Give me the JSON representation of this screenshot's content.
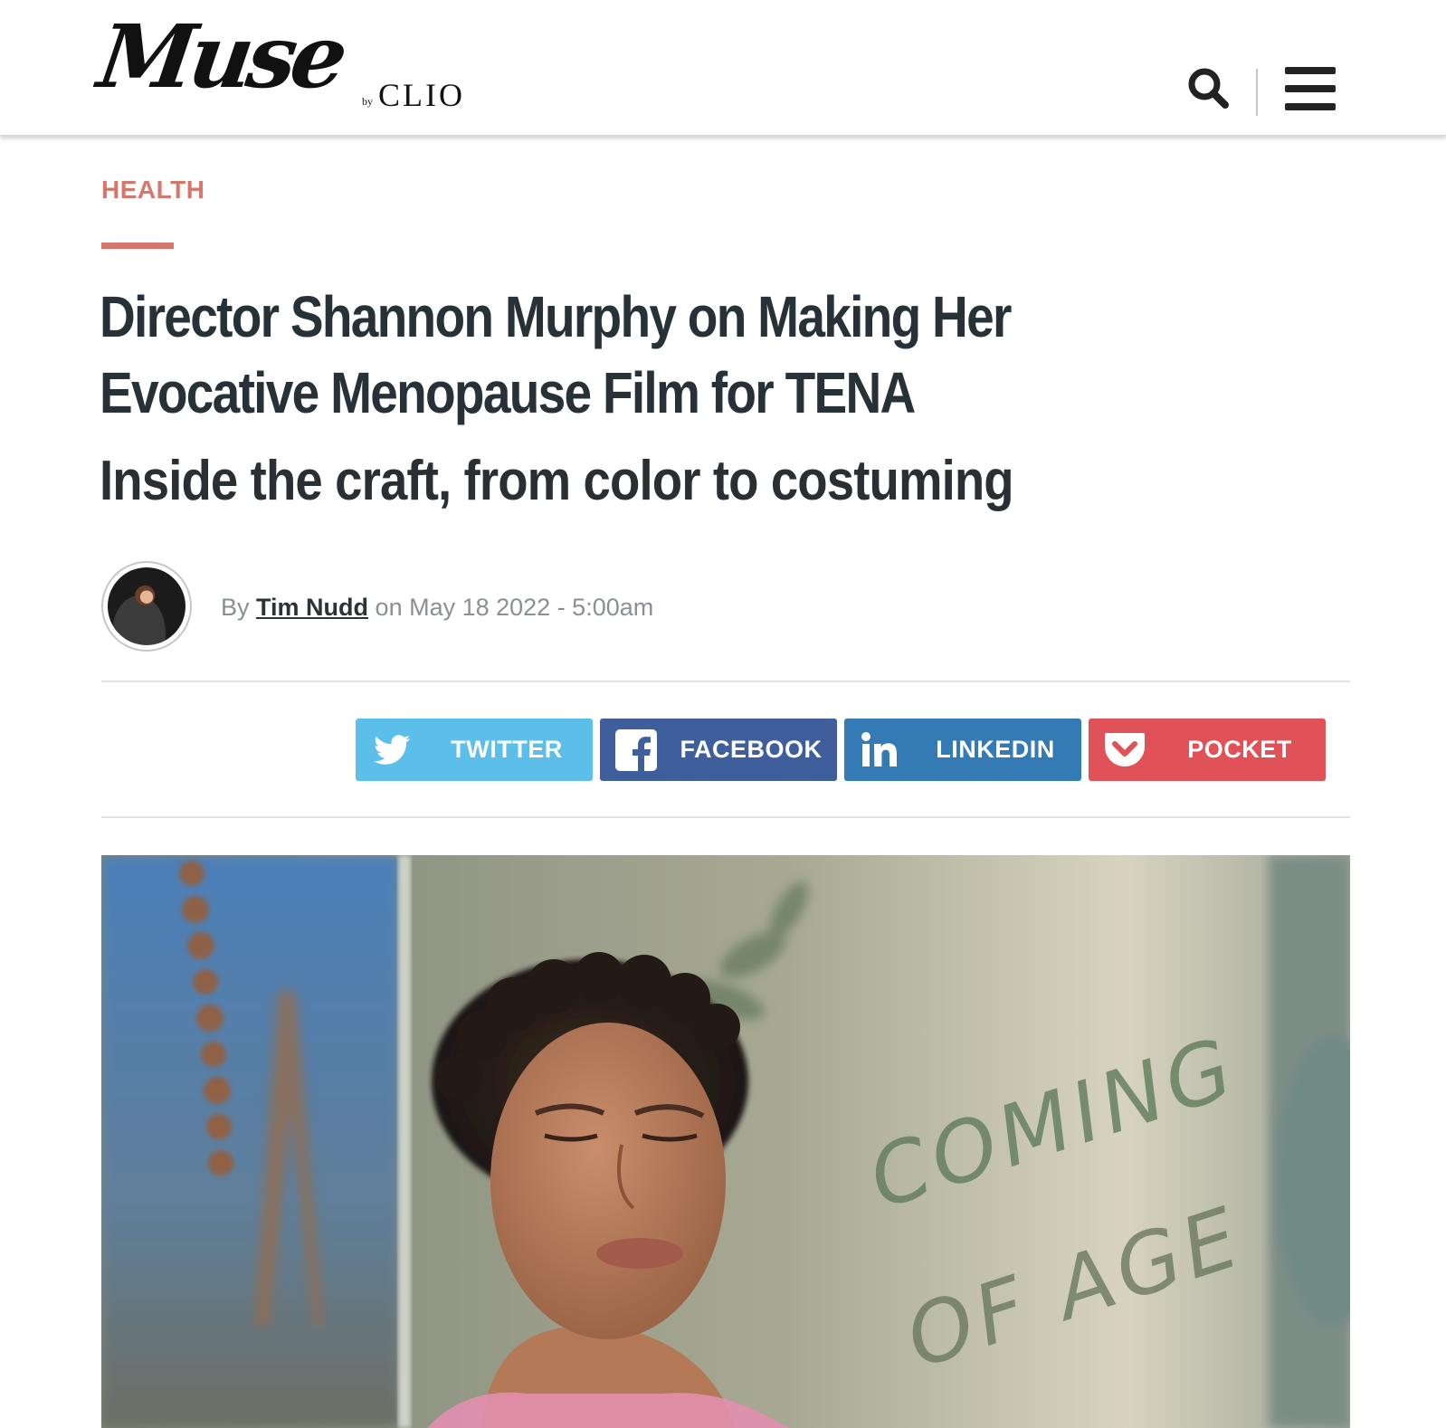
{
  "header": {
    "logo_primary": "Muse",
    "logo_by": "by",
    "logo_secondary": "CLIO",
    "search_icon": "search-icon",
    "menu_icon": "hamburger-menu-icon"
  },
  "article": {
    "category": "HEALTH",
    "headline_line1": "Director Shannon Murphy on Making Her",
    "headline_line2": "Evocative Menopause Film for TENA",
    "dek": "Inside the craft, from color to costuming",
    "byline": {
      "prefix": "By",
      "author": "Tim Nudd",
      "date_text": "on May 18 2022 - 5:00am"
    }
  },
  "share": {
    "buttons": [
      {
        "label": "TWITTER",
        "icon": "twitter-bird-icon",
        "color": "#5bbfea"
      },
      {
        "label": "FACEBOOK",
        "icon": "facebook-icon",
        "color": "#3f5f9c"
      },
      {
        "label": "LINKEDIN",
        "icon": "linkedin-icon",
        "color": "#347bb6"
      },
      {
        "label": "POCKET",
        "icon": "pocket-icon",
        "color": "#e05258"
      }
    ]
  },
  "hero": {
    "mirror_text_line1": "COMING",
    "mirror_text_line2": "OF AGE"
  },
  "colors": {
    "accent": "#d5776b",
    "headline": "#263238",
    "meta": "#8a8f93"
  }
}
